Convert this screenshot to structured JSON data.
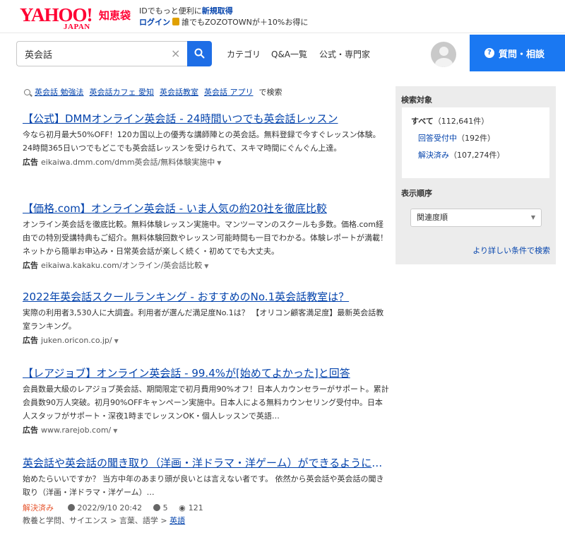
{
  "header": {
    "logo_yahoo": "YAHOO!",
    "logo_japan": "JAPAN",
    "logo_service": "知恵袋",
    "promo_line1_pre": "IDでもっと便利に",
    "promo_line1_link": "新規取得",
    "promo_line2_login": "ログイン",
    "promo_line2_text": "誰でもZOZOTOWNが＋10%お得に",
    "search_value": "英会話",
    "nav": [
      "カテゴリ",
      "Q&A一覧",
      "公式・専門家"
    ],
    "ask_label": "質問・相談"
  },
  "related": {
    "terms": [
      "英会話 勉強法",
      "英会話カフェ 愛知",
      "英会話教室",
      "英会話 アプリ"
    ],
    "suffix": "で検索"
  },
  "results": [
    {
      "title": "【公式】DMMオンライン英会話 - 24時間いつでも英会話レッスン",
      "desc": "今なら初月最大50%OFF！120カ国以上の優秀な講師陣との英会話。無料登録で今すぐレッスン体験。24時間365日いつでもどこでも英会話レッスンを受けられて、スキマ時間にぐんぐん上達。",
      "ad": "広告",
      "url": "eikaiwa.dmm.com/dmm英会話/無料体験実施中"
    },
    {
      "title": "【価格.com】オンライン英会話 - いま人気の約20社を徹底比較",
      "desc": "オンライン英会話を徹底比較。無料体験レッスン実施中。マンツーマンのスクールも多数。価格.com経由での特別受講特典もご紹介。無料体験回数やレッスン可能時間も一目でわかる。体験レポートが満載！ ネットから簡単お申込み・日常英会話が楽しく続く・初めてでも大丈夫。",
      "ad": "広告",
      "url": "eikaiwa.kakaku.com/オンライン/英会話比較"
    },
    {
      "title": "2022年英会話スクールランキング - おすすめのNo.1英会話教室は？",
      "desc": "実際の利用者3,530人に大調査。利用者が選んだ満足度No.1は？ 【オリコン顧客満足度】最新英会話教室ランキング。",
      "ad": "広告",
      "url": "juken.oricon.co.jp/"
    },
    {
      "title": "【レアジョブ】オンライン英会話 - 99.4%が[始めてよかった]と回答",
      "desc": "会員数最大級のレアジョブ英会話、期間限定で初月費用90%オフ！日本人カウンセラーがサポート。累計会員数90万人突破。初月90%OFFキャンペーン実施中。日本人による無料カウンセリング受付中。日本人スタッフがサポート・深夜1時までレッスンOK・個人レッスンで英語…",
      "ad": "広告",
      "url": "www.rarejob.com/"
    }
  ],
  "qa": {
    "title": "英会話や英会話の聞き取り（洋画・洋ドラマ・洋ゲーム）ができるようにな…",
    "desc": "始めたらいいですか？ 当方中年のあまり頭が良いとは言えない者です。 依然から英会話や英会話の聞き取り（洋画・洋ドラマ・洋ゲーム）…",
    "status": "解決済み",
    "date": "2022/9/10 20:42",
    "answers": "5",
    "views": "121",
    "crumbs": [
      "教養と学問、サイエンス",
      "言葉、語学",
      "英語"
    ]
  },
  "sidebar": {
    "target_heading": "検索対象",
    "options": [
      {
        "label": "すべて",
        "count": "（112,641件）"
      },
      {
        "label": "回答受付中",
        "count": "（192件）"
      },
      {
        "label": "解決済み",
        "count": "（107,274件）"
      }
    ],
    "sort_heading": "表示順序",
    "sort_value": "関連度順",
    "advanced_link": "より詳しい条件で検索"
  }
}
